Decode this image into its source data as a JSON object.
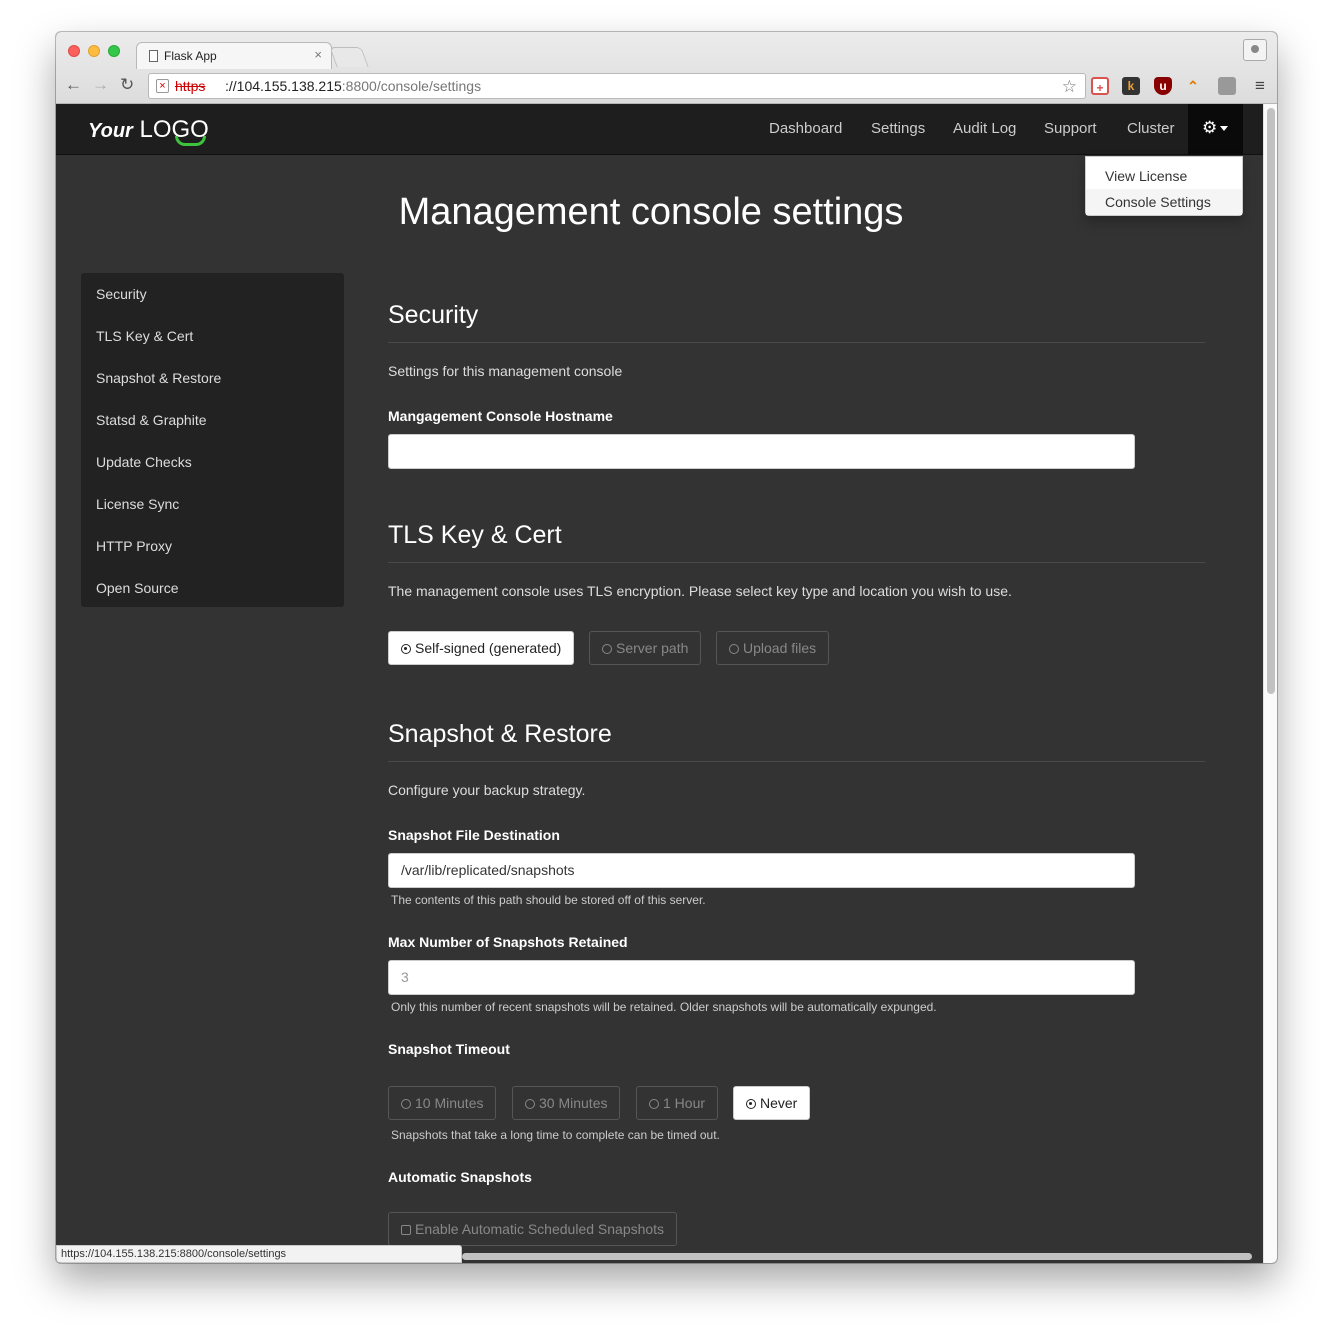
{
  "browser": {
    "tab_title": "Flask App",
    "tab_close": "×",
    "url_scheme": "https",
    "url_host": "://104.155.138.215",
    "url_path": ":8800/console/settings",
    "status_url": "https://104.155.138.215:8800/console/settings"
  },
  "logo": {
    "your": "Your",
    "lo": "LO",
    "go": "GO"
  },
  "nav": {
    "dashboard": "Dashboard",
    "settings": "Settings",
    "audit_log": "Audit Log",
    "support": "Support",
    "cluster": "Cluster"
  },
  "dropdown": {
    "view_license": "View License",
    "console_settings": "Console Settings"
  },
  "page_title": "Management console settings",
  "sidebar": {
    "items": [
      {
        "label": "Security"
      },
      {
        "label": "TLS Key & Cert"
      },
      {
        "label": "Snapshot & Restore"
      },
      {
        "label": "Statsd & Graphite"
      },
      {
        "label": "Update Checks"
      },
      {
        "label": "License Sync"
      },
      {
        "label": "HTTP Proxy"
      },
      {
        "label": "Open Source"
      }
    ]
  },
  "security": {
    "heading": "Security",
    "lead": "Settings for this management console",
    "hostname_label": "Mangagement Console Hostname",
    "hostname_value": ""
  },
  "tls": {
    "heading": "TLS Key & Cert",
    "lead": "The management console uses TLS encryption. Please select key type and location you wish to use.",
    "options": [
      "Self-signed (generated)",
      "Server path",
      "Upload files"
    ],
    "selected": "Self-signed (generated)"
  },
  "snapshot": {
    "heading": "Snapshot & Restore",
    "lead": "Configure your backup strategy.",
    "dest_label": "Snapshot File Destination",
    "dest_value": "/var/lib/replicated/snapshots",
    "dest_help": "The contents of this path should be stored off of this server.",
    "max_label": "Max Number of Snapshots Retained",
    "max_placeholder": "3",
    "max_help": "Only this number of recent snapshots will be retained. Older snapshots will be automatically expunged.",
    "timeout_label": "Snapshot Timeout",
    "timeout_options": [
      "10 Minutes",
      "30 Minutes",
      "1 Hour",
      "Never"
    ],
    "timeout_selected": "Never",
    "timeout_help": "Snapshots that take a long time to complete can be timed out.",
    "auto_label": "Automatic Snapshots",
    "auto_option": "Enable Automatic Scheduled Snapshots",
    "auto_enabled": false
  }
}
